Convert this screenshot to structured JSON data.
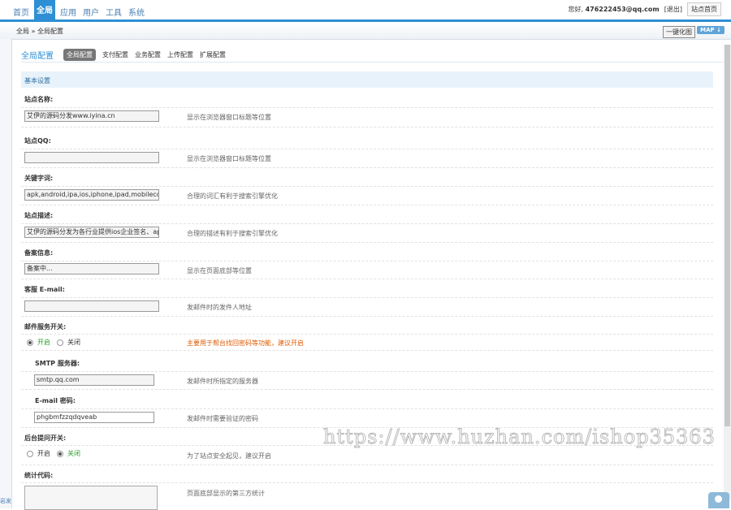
{
  "nav": [
    "首页",
    "全局",
    "应用",
    "用户",
    "工具",
    "系统"
  ],
  "user": {
    "greeting": "您好,",
    "email": "476222453@qq.com",
    "logout": "[退出]",
    "site_home": "站点首页"
  },
  "breadcrumb": "全局 » 全局配置",
  "toolbar": {
    "onekey": "一键化图",
    "map": "MAP ↓"
  },
  "left_fragment": "岩发",
  "tabs": {
    "title": "全局配置",
    "items": [
      "全局配置",
      "支付配置",
      "业务配置",
      "上传配置",
      "扩展配置"
    ]
  },
  "section_title": "基本设置",
  "fields": [
    {
      "label": "站点名称:",
      "value": "艾伊的源码分发www.iyina.cn",
      "hint": "显示在浏览器窗口标题等位置"
    },
    {
      "label": "站点QQ:",
      "value": "",
      "hint": "显示在浏览器窗口标题等位置"
    },
    {
      "label": "关键字词:",
      "value": "apk,android,ipa,ios,iphone,ipad,mobilecor",
      "hint": "合理的词汇有利于搜索引擎优化"
    },
    {
      "label": "站点描述:",
      "value": "艾伊的源码分发为各行业提供ios企业签名、app",
      "hint": "合理的描述有利于搜索引擎优化"
    },
    {
      "label": "备案信息:",
      "value": "备案中...",
      "hint": "显示在页面底部等位置"
    },
    {
      "label": "客服 E-mail:",
      "value": "",
      "hint": "发邮件时的发件人地址"
    }
  ],
  "mail": {
    "label": "邮件服务开关:",
    "on": "开启",
    "off": "关闭",
    "hint": "主要用于帮台找回密码等功能，建议开启",
    "smtp_label": "SMTP 服务器:",
    "smtp_value": "smtp.qq.com",
    "smtp_hint": "发邮件时所指定的服务器",
    "pass_label": "E-mail 密码:",
    "pass_value": "phgbmfzzqdqveab",
    "pass_hint": "发邮件时需要验证的密码"
  },
  "admin": {
    "label": "后台提问开关:",
    "on": "开启",
    "off": "关闭",
    "hint": "为了站点安全起见，建议开启"
  },
  "stats": {
    "label": "统计代码:",
    "hint": "页面底部显示的第三方统计"
  },
  "watermark": "https://www.huzhan.com/ishop35363"
}
